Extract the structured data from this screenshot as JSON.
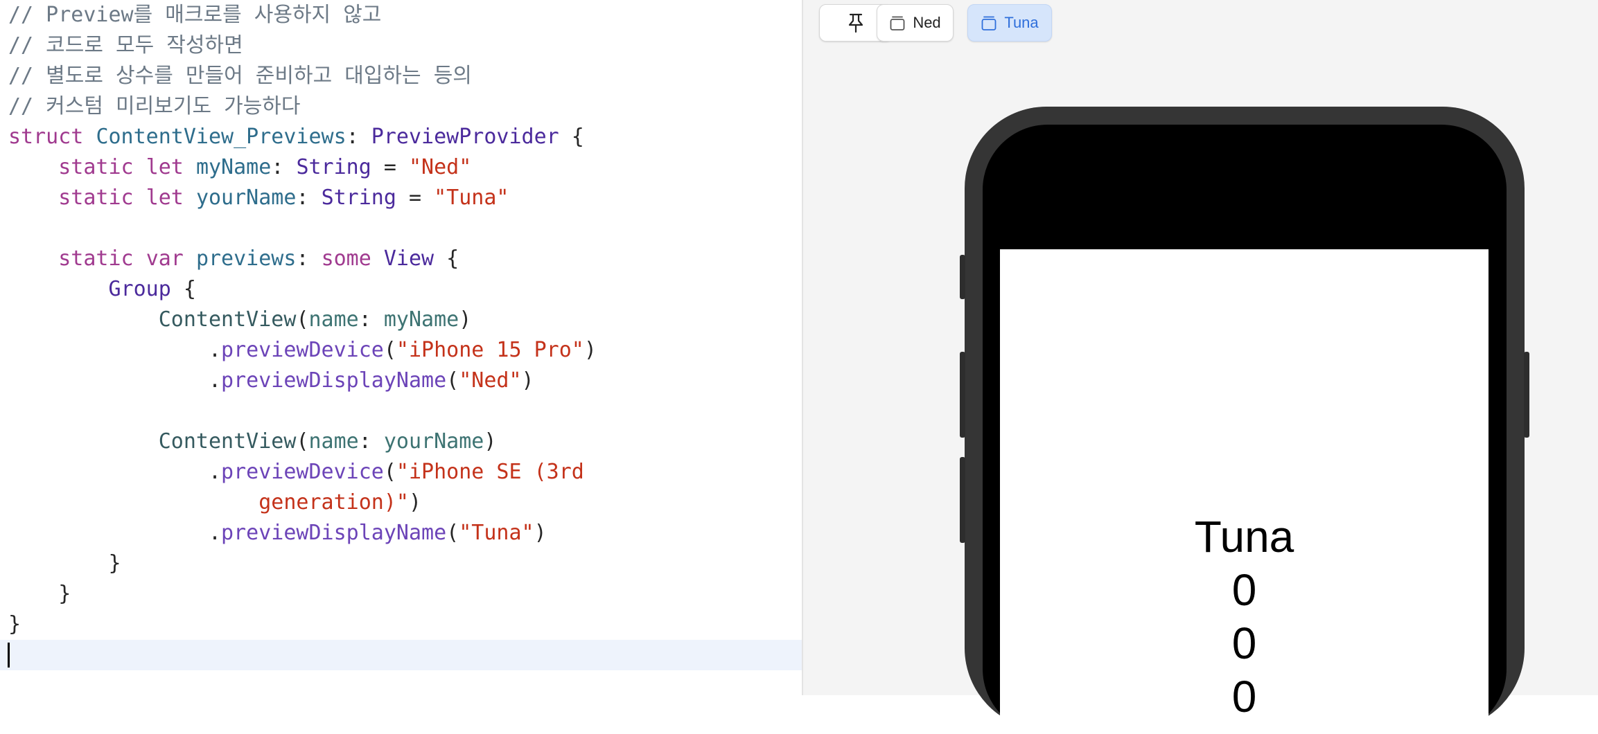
{
  "colors": {
    "comment": "#6c7986",
    "keyword": "#a03a8f",
    "type": "#4b2a9c",
    "member": "#2e6d8c",
    "string": "#c4321a",
    "call": "#355a5f",
    "param": "#3d7372",
    "method": "#6c44b8",
    "plain": "#262626",
    "current_line": "#eef3fc",
    "preview_bg": "#f4f4f4",
    "chip_selected_bg": "#d6e5fb",
    "chip_selected_text": "#2f6fdb"
  },
  "editor": {
    "lines": [
      {
        "tokens": [
          {
            "text": "// Preview를 매크로를 사용하지 않고",
            "kind": "comment"
          }
        ]
      },
      {
        "tokens": [
          {
            "text": "// 코드로 모두 작성하면",
            "kind": "comment"
          }
        ]
      },
      {
        "tokens": [
          {
            "text": "// 별도로 상수를 만들어 준비하고 대입하는 등의",
            "kind": "comment"
          }
        ]
      },
      {
        "tokens": [
          {
            "text": "// 커스텀 미리보기도 가능하다",
            "kind": "comment"
          }
        ]
      },
      {
        "tokens": [
          {
            "text": "struct",
            "kind": "keyword"
          },
          {
            "text": " ",
            "kind": "plain"
          },
          {
            "text": "ContentView_Previews",
            "kind": "member"
          },
          {
            "text": ": ",
            "kind": "plain"
          },
          {
            "text": "PreviewProvider",
            "kind": "type"
          },
          {
            "text": " {",
            "kind": "plain"
          }
        ]
      },
      {
        "tokens": [
          {
            "text": "    ",
            "kind": "plain"
          },
          {
            "text": "static",
            "kind": "keyword"
          },
          {
            "text": " ",
            "kind": "plain"
          },
          {
            "text": "let",
            "kind": "keyword"
          },
          {
            "text": " ",
            "kind": "plain"
          },
          {
            "text": "myName",
            "kind": "member"
          },
          {
            "text": ": ",
            "kind": "plain"
          },
          {
            "text": "String",
            "kind": "type"
          },
          {
            "text": " = ",
            "kind": "plain"
          },
          {
            "text": "\"Ned\"",
            "kind": "string"
          }
        ]
      },
      {
        "tokens": [
          {
            "text": "    ",
            "kind": "plain"
          },
          {
            "text": "static",
            "kind": "keyword"
          },
          {
            "text": " ",
            "kind": "plain"
          },
          {
            "text": "let",
            "kind": "keyword"
          },
          {
            "text": " ",
            "kind": "plain"
          },
          {
            "text": "yourName",
            "kind": "member"
          },
          {
            "text": ": ",
            "kind": "plain"
          },
          {
            "text": "String",
            "kind": "type"
          },
          {
            "text": " = ",
            "kind": "plain"
          },
          {
            "text": "\"Tuna\"",
            "kind": "string"
          }
        ]
      },
      {
        "tokens": []
      },
      {
        "tokens": [
          {
            "text": "    ",
            "kind": "plain"
          },
          {
            "text": "static",
            "kind": "keyword"
          },
          {
            "text": " ",
            "kind": "plain"
          },
          {
            "text": "var",
            "kind": "keyword"
          },
          {
            "text": " ",
            "kind": "plain"
          },
          {
            "text": "previews",
            "kind": "member"
          },
          {
            "text": ": ",
            "kind": "plain"
          },
          {
            "text": "some",
            "kind": "keyword"
          },
          {
            "text": " ",
            "kind": "plain"
          },
          {
            "text": "View",
            "kind": "type"
          },
          {
            "text": " {",
            "kind": "plain"
          }
        ]
      },
      {
        "tokens": [
          {
            "text": "        ",
            "kind": "plain"
          },
          {
            "text": "Group",
            "kind": "type"
          },
          {
            "text": " {",
            "kind": "plain"
          }
        ]
      },
      {
        "tokens": [
          {
            "text": "            ",
            "kind": "plain"
          },
          {
            "text": "ContentView",
            "kind": "call"
          },
          {
            "text": "(",
            "kind": "plain"
          },
          {
            "text": "name",
            "kind": "param"
          },
          {
            "text": ": ",
            "kind": "plain"
          },
          {
            "text": "myName",
            "kind": "param"
          },
          {
            "text": ")",
            "kind": "plain"
          }
        ]
      },
      {
        "tokens": [
          {
            "text": "                .",
            "kind": "plain"
          },
          {
            "text": "previewDevice",
            "kind": "method"
          },
          {
            "text": "(",
            "kind": "plain"
          },
          {
            "text": "\"iPhone 15 Pro\"",
            "kind": "string"
          },
          {
            "text": ")",
            "kind": "plain"
          }
        ]
      },
      {
        "tokens": [
          {
            "text": "                .",
            "kind": "plain"
          },
          {
            "text": "previewDisplayName",
            "kind": "method"
          },
          {
            "text": "(",
            "kind": "plain"
          },
          {
            "text": "\"Ned\"",
            "kind": "string"
          },
          {
            "text": ")",
            "kind": "plain"
          }
        ]
      },
      {
        "tokens": []
      },
      {
        "tokens": [
          {
            "text": "            ",
            "kind": "plain"
          },
          {
            "text": "ContentView",
            "kind": "call"
          },
          {
            "text": "(",
            "kind": "plain"
          },
          {
            "text": "name",
            "kind": "param"
          },
          {
            "text": ": ",
            "kind": "plain"
          },
          {
            "text": "yourName",
            "kind": "param"
          },
          {
            "text": ")",
            "kind": "plain"
          }
        ]
      },
      {
        "tokens": [
          {
            "text": "                .",
            "kind": "plain"
          },
          {
            "text": "previewDevice",
            "kind": "method"
          },
          {
            "text": "(",
            "kind": "plain"
          },
          {
            "text": "\"iPhone SE (3rd",
            "kind": "string"
          }
        ]
      },
      {
        "tokens": [
          {
            "text": "                    ",
            "kind": "plain"
          },
          {
            "text": "generation)\"",
            "kind": "string"
          },
          {
            "text": ")",
            "kind": "plain"
          }
        ]
      },
      {
        "tokens": [
          {
            "text": "                .",
            "kind": "plain"
          },
          {
            "text": "previewDisplayName",
            "kind": "method"
          },
          {
            "text": "(",
            "kind": "plain"
          },
          {
            "text": "\"Tuna\"",
            "kind": "string"
          },
          {
            "text": ")",
            "kind": "plain"
          }
        ]
      },
      {
        "tokens": [
          {
            "text": "        }",
            "kind": "plain"
          }
        ]
      },
      {
        "tokens": [
          {
            "text": "    }",
            "kind": "plain"
          }
        ]
      },
      {
        "tokens": [
          {
            "text": "}",
            "kind": "plain"
          }
        ]
      },
      {
        "tokens": [],
        "current": true
      }
    ]
  },
  "preview": {
    "toolbar": {
      "pin_icon": "pin-icon",
      "chips": [
        {
          "label": "Ned",
          "icon": "device-stack-icon",
          "selected": false
        },
        {
          "label": "Tuna",
          "icon": "device-stack-icon",
          "selected": true
        }
      ]
    },
    "device": {
      "name": "Tuna",
      "counts": [
        "0",
        "0",
        "0"
      ]
    }
  }
}
